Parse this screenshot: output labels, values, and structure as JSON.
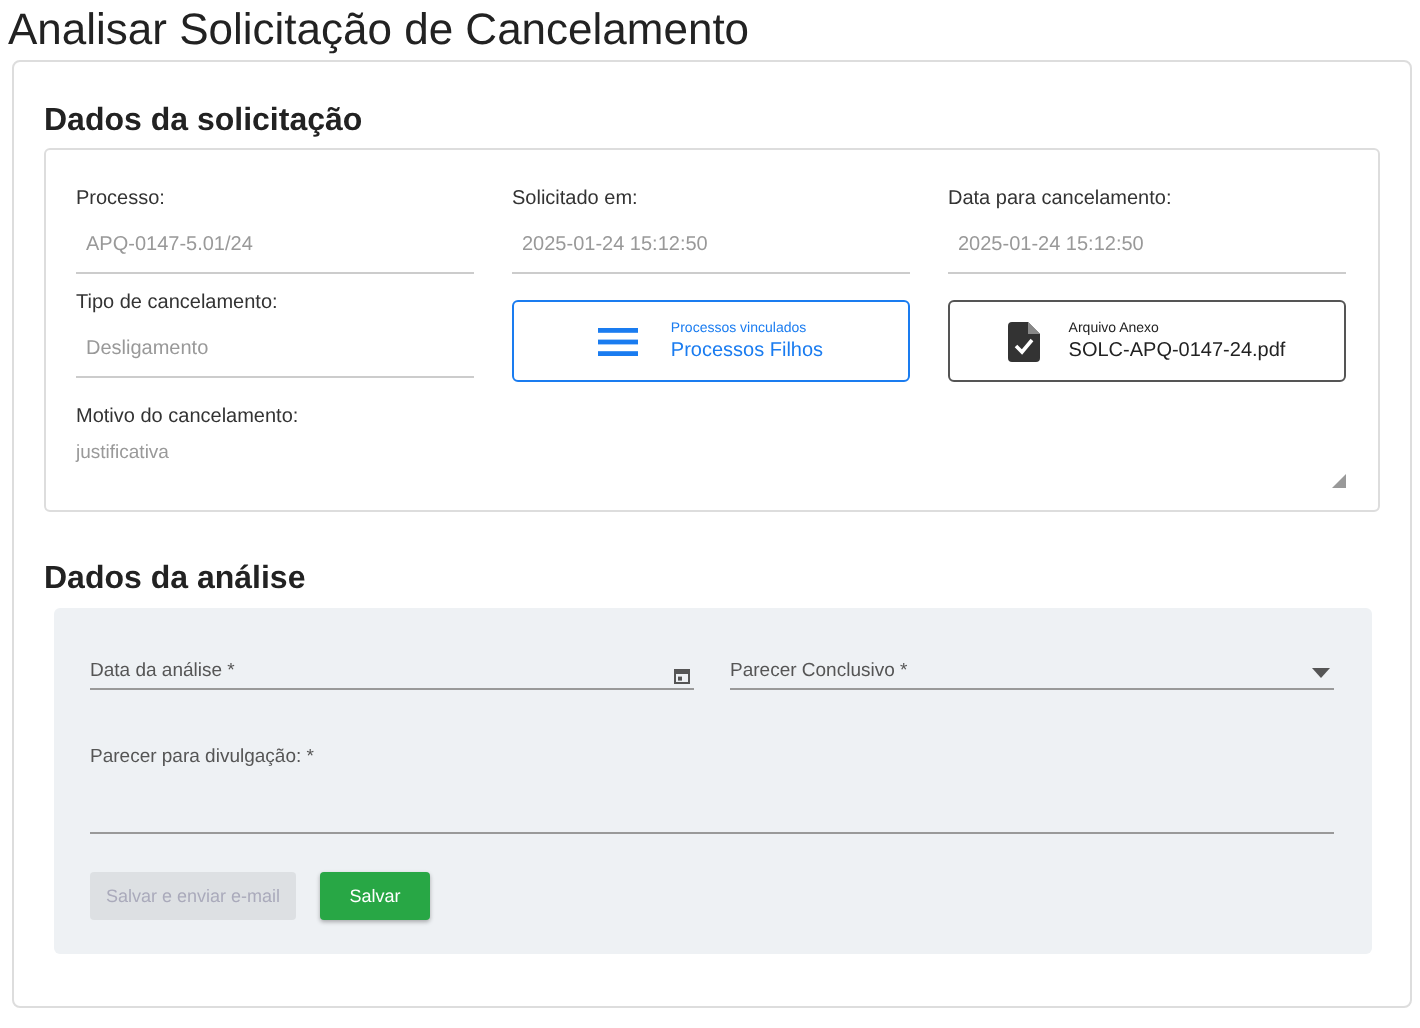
{
  "page_title": "Analisar Solicitação de Cancelamento",
  "request": {
    "title": "Dados da solicitação",
    "fields": [
      {
        "label": "Processo:",
        "value": "APQ-0147-5.01/24"
      },
      {
        "label": "Solicitado em:",
        "value": "2025-01-24 15:12:50"
      },
      {
        "label": "Data para cancelamento:",
        "value": "2025-01-24 15:12:50"
      },
      {
        "label": "Tipo de cancelamento:",
        "value": "Desligamento"
      }
    ],
    "linked": {
      "caption": "Processos vinculados",
      "label": "Processos Filhos"
    },
    "attachment": {
      "caption": "Arquivo Anexo",
      "label": "SOLC-APQ-0147-24.pdf"
    },
    "reason": {
      "label": "Motivo do cancelamento:",
      "value": "justificativa"
    }
  },
  "analysis": {
    "title": "Dados da análise",
    "date_field": {
      "placeholder": "Data da análise *"
    },
    "conclusion_field": {
      "placeholder": "Parecer Conclusivo *"
    },
    "disclosure_field": {
      "placeholder": "Parecer para divulgação: *"
    },
    "buttons": [
      {
        "label": "Salvar e enviar e-mail",
        "disabled": true
      },
      {
        "label": "Salvar",
        "disabled": false
      }
    ]
  }
}
